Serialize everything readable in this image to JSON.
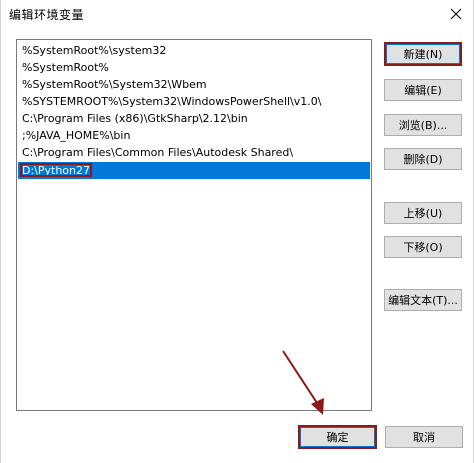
{
  "window": {
    "title": "编辑环境变量"
  },
  "path_list": [
    "%SystemRoot%\\system32",
    "%SystemRoot%",
    "%SystemRoot%\\System32\\Wbem",
    "%SYSTEMROOT%\\System32\\WindowsPowerShell\\v1.0\\",
    "C:\\Program Files (x86)\\GtkSharp\\2.12\\bin",
    ";%JAVA_HOME%\\bin",
    "C:\\Program Files\\Common Files\\Autodesk Shared\\",
    "D:\\Python27"
  ],
  "selected_index": 7,
  "buttons": {
    "new": "新建(N)",
    "edit": "编辑(E)",
    "browse": "浏览(B)...",
    "delete": "删除(D)",
    "move_up": "上移(U)",
    "move_down": "下移(O)",
    "edit_text": "编辑文本(T)...",
    "ok": "确定",
    "cancel": "取消"
  },
  "colors": {
    "selection": "#0078d7",
    "annotation": "#8b1a1a"
  }
}
